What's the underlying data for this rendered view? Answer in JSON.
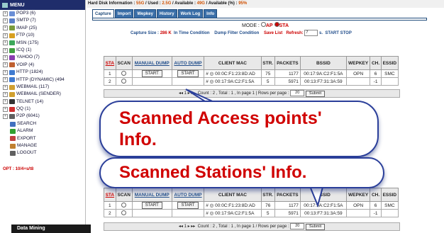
{
  "sidebar": {
    "menu_label": "MENU",
    "items": [
      {
        "label": "POP3 (6)",
        "color": "#6b8fd6"
      },
      {
        "label": "SMTP (7)",
        "color": "#5a7fc8"
      },
      {
        "label": "IMAP (25)",
        "color": "#7a9b3c"
      },
      {
        "label": "FTP (10)",
        "color": "#d8a020"
      },
      {
        "label": "MSN (175)",
        "color": "#3ca85a"
      },
      {
        "label": "ICQ (1)",
        "color": "#40a040"
      },
      {
        "label": "YAHOO (7)",
        "color": "#8a3cb0"
      },
      {
        "label": "VOIP (4)",
        "color": "#c06030"
      },
      {
        "label": "HTTP (1824)",
        "color": "#3f7ad0"
      },
      {
        "label": "HTTP (DYNAMIC) (494",
        "color": "#3f7ad0"
      },
      {
        "label": "WEBMAIL (117)",
        "color": "#d0a030"
      },
      {
        "label": "WEBMAIL (SENDER)",
        "color": "#d0a030"
      },
      {
        "label": "TELNET (14)",
        "color": "#333333"
      },
      {
        "label": "QQ (1)",
        "color": "#d03030"
      },
      {
        "label": "P2P (6041)",
        "color": "#606060"
      }
    ],
    "leaves": [
      {
        "label": "SEARCH",
        "color": "#4070c0"
      },
      {
        "label": "ALARM",
        "color": "#30a030"
      },
      {
        "label": "EXPORT",
        "color": "#c04040"
      },
      {
        "label": "MANAGE",
        "color": "#c08030"
      },
      {
        "label": "LOGOUT",
        "color": "#606060"
      }
    ],
    "opt_text": "OPT : 10/4+s/t8",
    "data_mining": "Data Mining"
  },
  "header": {
    "hd_label": "Hard Disk Information : ",
    "hd_total": "55G",
    "hd_used_label": " / Used : ",
    "hd_used": "2.5G",
    "hd_avail_label": " / Available : ",
    "hd_avail": "49G",
    "hd_pct_label": " / Available (%) : ",
    "hd_pct": "95%"
  },
  "tabs": [
    "Capture",
    "Import",
    "Wepkey",
    "History",
    "Work Log",
    "Info"
  ],
  "mode": {
    "label": "MODE :",
    "ap": "AP",
    "sta": "STA"
  },
  "controls": {
    "capture_size_label": "Capture Size :",
    "capture_size": "286 K",
    "in_time": "In Time Condition",
    "dump_filter": "Dump Filter Condition",
    "save_list": "Save List",
    "refresh_label": "Refresh:",
    "refresh_value": "7",
    "refresh_unit": "s.",
    "start_stop": "START STOP"
  },
  "table": {
    "headers": [
      "STA",
      "SCAN",
      "MANUAL DUMP",
      "AUTO DUMP",
      "CLIENT MAC",
      "STR.",
      "PACKETS",
      "BSSID",
      "WEPKEY",
      "CH.",
      "ESSID"
    ],
    "rows": [
      {
        "num": "1",
        "manual": "START",
        "auto": "START",
        "mac": "00:0C:F1:23:8D:AD",
        "str": "75",
        "packets": "1177",
        "bssid": "00:17:9A:C2:F1:5A",
        "wepkey": "OPN",
        "ch": "6",
        "essid": "SMC"
      },
      {
        "num": "2",
        "manual": "",
        "auto": "",
        "mac": "00:17:9A:C2:F1:5A",
        "str": "5",
        "packets": "5971",
        "bssid": "00:13:F7:31:3A:59",
        "wepkey": "",
        "ch": "-1",
        "essid": ""
      }
    ],
    "pager": "Count : 2 , Total : 1 , In page  1  | Rows per page :",
    "rows_per_page": "20",
    "submit": "Submit",
    "nav": "◂◂ 1 ▸ ▸▸"
  },
  "table2": {
    "rows": [
      {
        "num": "1",
        "manual": "START",
        "auto": "START",
        "mac": "00:0C:F1:23:8D:AD",
        "str": "76",
        "packets": "1177",
        "bssid": "00:17:9A:C2:F1:5A",
        "wepkey": "OPN",
        "ch": "6",
        "essid": "SMC"
      },
      {
        "num": "2",
        "manual": "",
        "auto": "",
        "mac": "00:17:9A:C2:F1:5A",
        "str": "5",
        "packets": "5971",
        "bssid": "00:13:F7:31:3A:59",
        "wepkey": "",
        "ch": "-1",
        "essid": ""
      }
    ],
    "pager": "Count : 2 , Total : 1 , In page  1  / Rows per page :"
  },
  "callouts": {
    "ap": "Scanned Access points' Info.",
    "sta": "Scanned Stations' Info."
  }
}
